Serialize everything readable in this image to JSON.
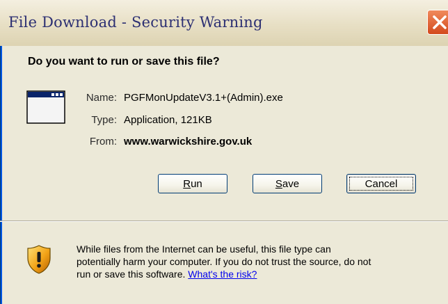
{
  "window": {
    "title": "File Download - Security Warning"
  },
  "dialog": {
    "question": "Do you want to run or save this file?",
    "fields": [
      {
        "label": "Name:",
        "value": "PGFMonUpdateV3.1+(Admin).exe"
      },
      {
        "label": "Type:",
        "value": "Application, 121KB"
      },
      {
        "label": "From:",
        "value": "www.warwickshire.gov.uk"
      }
    ],
    "buttons": {
      "run": {
        "accel": "R",
        "rest": "un"
      },
      "save": {
        "accel": "S",
        "rest": "ave"
      },
      "cancel": "Cancel"
    },
    "warning": {
      "line1": "While files from the Internet can be useful, this file type can",
      "line2": "potentially harm your computer. If you do not trust the source, do not",
      "line3_prefix": "run or save this software.",
      "link": "What's the risk?"
    }
  },
  "colors": {
    "title_text": "#2c2f72",
    "close_button": "#d34a1d",
    "dialog_bg": "#ece9d8",
    "link": "#0000ee",
    "button_border": "#003c74"
  },
  "icons": [
    "close-icon",
    "application-file-icon",
    "security-shield-warning-icon"
  ]
}
